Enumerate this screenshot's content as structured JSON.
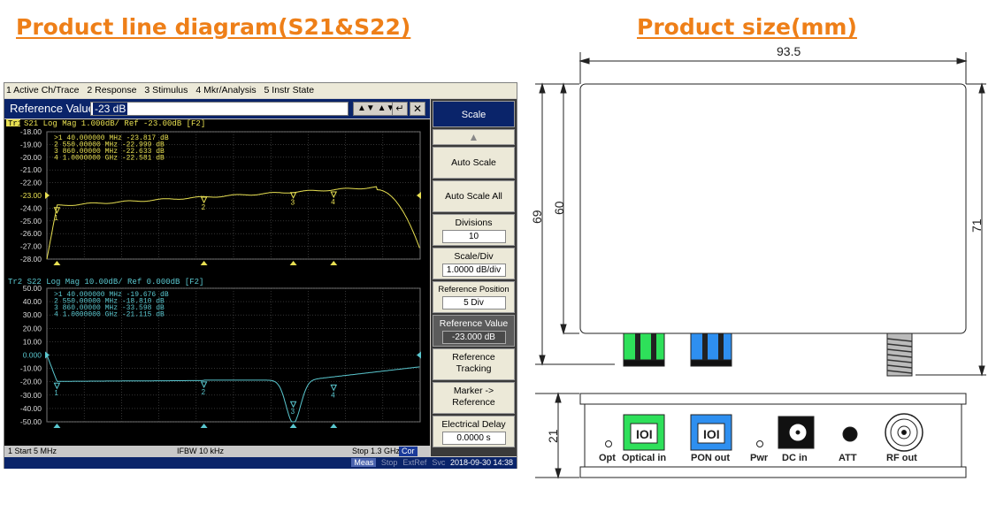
{
  "headings": {
    "left": "Product line diagram(S21&S22)",
    "right": "Product size(mm)"
  },
  "analyzer": {
    "menu": [
      "1 Active Ch/Trace",
      "2 Response",
      "3 Stimulus",
      "4 Mkr/Analysis",
      "5 Instr State"
    ],
    "entry": {
      "label": "Reference Value",
      "value": "-23 dB"
    },
    "trace1": {
      "header_tag": "Tr1",
      "header": "S21 Log Mag 1.000dB/ Ref -23.00dB [F2]",
      "color": "#e8e052",
      "yticks": [
        "-18.00",
        "-19.00",
        "-20.00",
        "-21.00",
        "-22.00",
        "-23.00",
        "-24.00",
        "-25.00",
        "-26.00",
        "-27.00",
        "-28.00"
      ],
      "markers": [
        ">1   40.000000 MHz -23.817 dB",
        " 2   550.00000 MHz -22.999 dB",
        " 3   860.00000 MHz -22.633 dB",
        " 4   1.0000000 GHz -22.581 dB"
      ],
      "marker_points": [
        {
          "label": "1",
          "freq_mhz": 40,
          "db": -23.817
        },
        {
          "label": "2",
          "freq_mhz": 550,
          "db": -22.999
        },
        {
          "label": "3",
          "freq_mhz": 860,
          "db": -22.633
        },
        {
          "label": "4",
          "freq_mhz": 1000,
          "db": -22.581
        }
      ]
    },
    "trace2": {
      "header": "Tr2 S22 Log Mag 10.00dB/ Ref 0.000dB [F2]",
      "color": "#5ac8d0",
      "yticks": [
        "50.00",
        "40.00",
        "30.00",
        "20.00",
        "10.00",
        "0.000",
        "-10.00",
        "-20.00",
        "-30.00",
        "-40.00",
        "-50.00"
      ],
      "markers": [
        ">1   40.000000 MHz -19.676 dB",
        " 2   550.00000 MHz -18.810 dB",
        " 3   860.00000 MHz -33.598 dB",
        " 4   1.0000000 GHz -21.115 dB"
      ],
      "marker_points": [
        {
          "label": "1",
          "freq_mhz": 40,
          "db": -19.676
        },
        {
          "label": "2",
          "freq_mhz": 550,
          "db": -18.81
        },
        {
          "label": "3",
          "freq_mhz": 860,
          "db": -33.598
        },
        {
          "label": "4",
          "freq_mhz": 1000,
          "db": -21.115
        }
      ]
    },
    "status": {
      "start": "1  Start 5 MHz",
      "ifbw": "IFBW 10 kHz",
      "stop": "Stop 1.3 GHz",
      "cor": "Cor"
    },
    "bottom": {
      "meas": "Meas",
      "stop": "Stop",
      "extref": "ExtRef",
      "svc": "Svc",
      "datetime": "2018-09-30 14:38"
    },
    "softkeys": {
      "title": "Scale",
      "auto_scale": "Auto Scale",
      "auto_scale_all": "Auto Scale All",
      "divisions": "Divisions",
      "divisions_val": "10",
      "scale_div": "Scale/Div",
      "scale_div_val": "1.0000 dB/div",
      "ref_pos": "Reference Position",
      "ref_pos_val": "5 Div",
      "ref_val": "Reference Value",
      "ref_val_val": "-23.000 dB",
      "ref_track1": "Reference",
      "ref_track2": "Tracking",
      "marker_ref1": "Marker ->",
      "marker_ref2": "Reference",
      "elec_delay": "Electrical Delay",
      "elec_delay_val": "0.0000 s"
    }
  },
  "drawing": {
    "dims": {
      "width": "93.5",
      "height_outer": "69",
      "height_inner": "60",
      "height_right": "71",
      "depth": "21"
    },
    "labels": [
      "Opt",
      "Optical in",
      "PON out",
      "Pwr",
      "DC in",
      "ATT",
      "RF out"
    ],
    "colors": {
      "optical": "#2ee05a",
      "pon": "#2e8ff0"
    }
  }
}
